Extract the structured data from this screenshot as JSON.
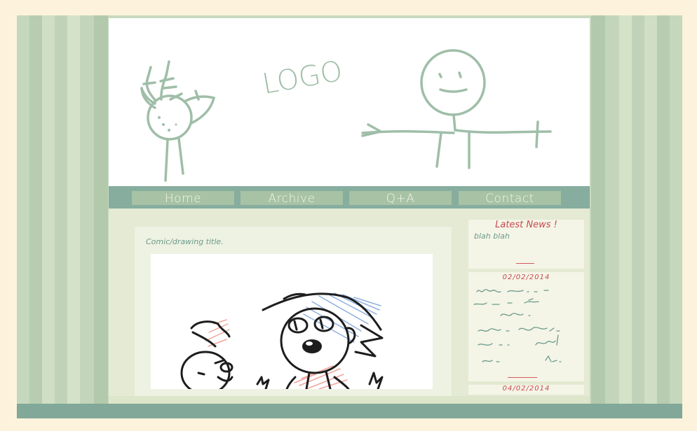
{
  "header": {
    "logo_text": "LOGO"
  },
  "nav": {
    "items": [
      {
        "label": "Home"
      },
      {
        "label": "Archive"
      },
      {
        "label": "Q+A"
      },
      {
        "label": "Contact"
      }
    ]
  },
  "post": {
    "title": "Comic/drawing title."
  },
  "sidebar": {
    "news_heading": "Latest News !",
    "news_preview": "blah blah",
    "entries": [
      {
        "date": "02/02/2014"
      },
      {
        "date": "04/02/2014"
      }
    ]
  },
  "colors": {
    "page_background": "#fdf3dc",
    "stripes": "#c5d7bd",
    "nav_bar": "#87ad9f",
    "nav_button": "#a7c2a4",
    "sketch": "#9fbea8",
    "accent_red": "#c9474e",
    "text_teal": "#6b9a8b"
  }
}
